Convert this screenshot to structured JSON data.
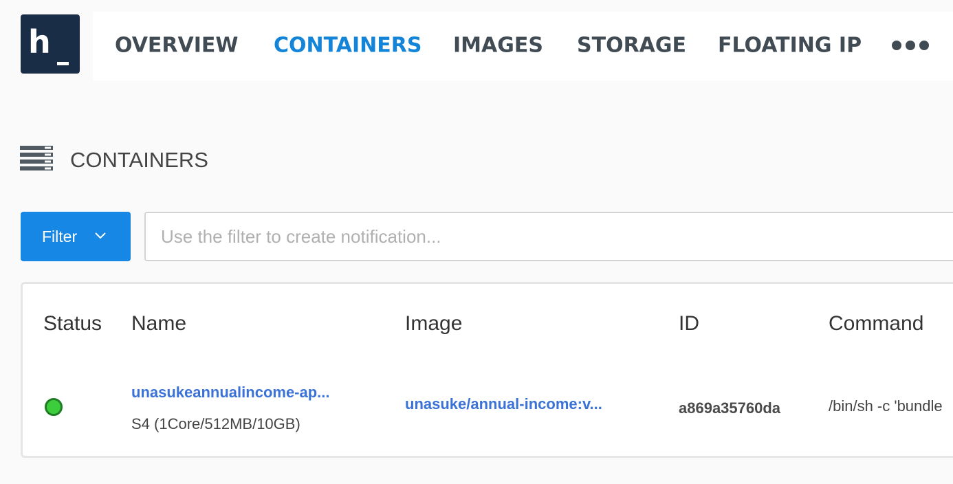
{
  "brand": {
    "logo_text": "h",
    "bg_color": "#1a2d46"
  },
  "nav": {
    "items": [
      {
        "label": "OVERVIEW",
        "active": false
      },
      {
        "label": "CONTAINERS",
        "active": true
      },
      {
        "label": "IMAGES",
        "active": false
      },
      {
        "label": "STORAGE",
        "active": false
      },
      {
        "label": "FLOATING IP",
        "active": false
      }
    ],
    "more_icon": "more-horizontal-icon",
    "active_color": "#1384d8"
  },
  "page": {
    "title": "CONTAINERS",
    "icon": "server-stack-icon"
  },
  "filter": {
    "button_label": "Filter",
    "button_icon": "chevron-down-icon",
    "placeholder": "Use the filter to create notification...",
    "value": "",
    "button_color": "#1787e6"
  },
  "table": {
    "columns": [
      "Status",
      "Name",
      "Image",
      "ID",
      "Command"
    ],
    "rows": [
      {
        "status": "running",
        "status_color": "#3ccc3c",
        "name": "unasukeannualincome-ap...",
        "plan": "S4 (1Core/512MB/10GB)",
        "image": "unasuke/annual-income:v...",
        "id": "a869a35760da",
        "command": "/bin/sh -c 'bundle"
      }
    ]
  }
}
